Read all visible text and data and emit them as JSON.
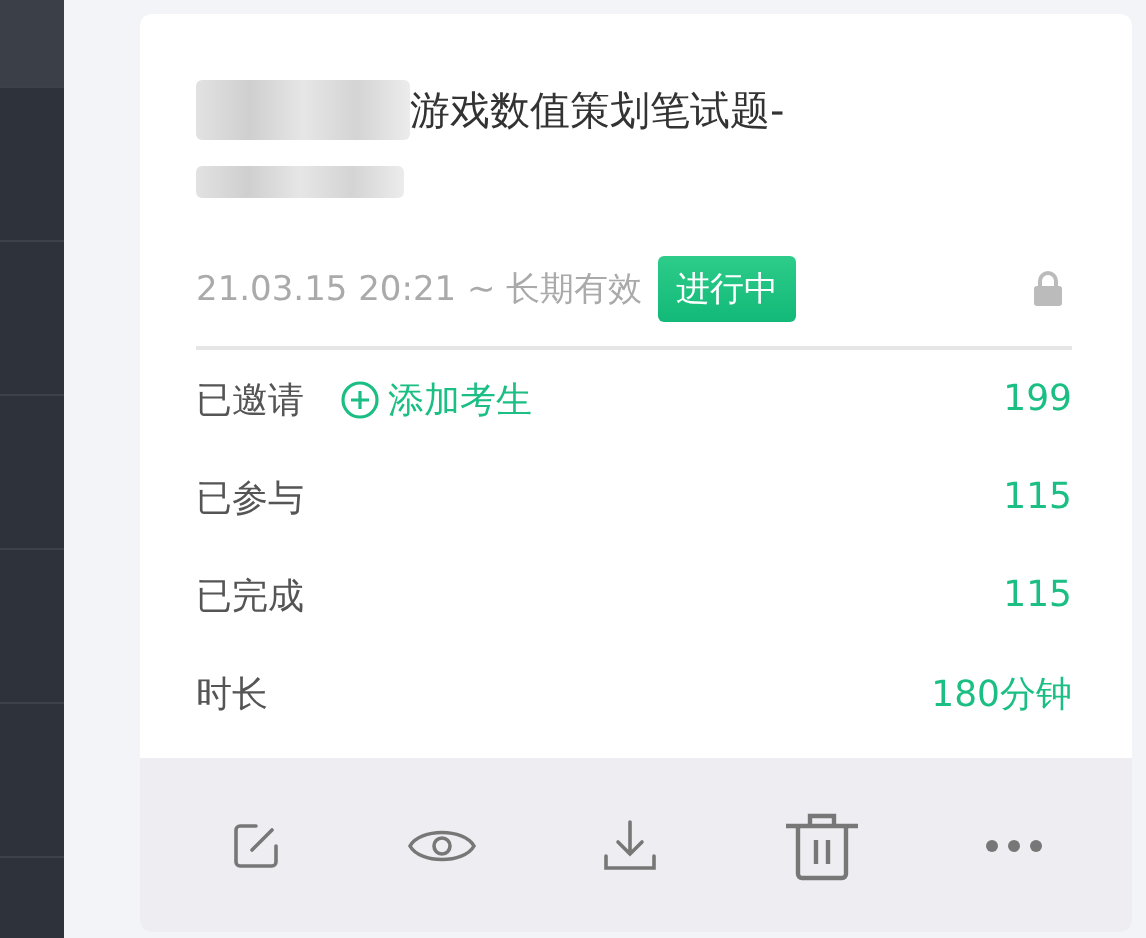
{
  "card": {
    "title": "游戏数值策划笔试题-",
    "time_range": "21.03.15 20:21 ~ 长期有效",
    "status": "进行中",
    "locked": true,
    "stats": [
      {
        "label": "已邀请",
        "link": "添加考生",
        "value": "199"
      },
      {
        "label": "已参与",
        "value": "115"
      },
      {
        "label": "已完成",
        "value": "115"
      },
      {
        "label": "时长",
        "value": "180分钟"
      }
    ],
    "actions": [
      {
        "kind": "edit"
      },
      {
        "kind": "view"
      },
      {
        "kind": "download"
      },
      {
        "kind": "delete"
      },
      {
        "kind": "more"
      }
    ]
  }
}
